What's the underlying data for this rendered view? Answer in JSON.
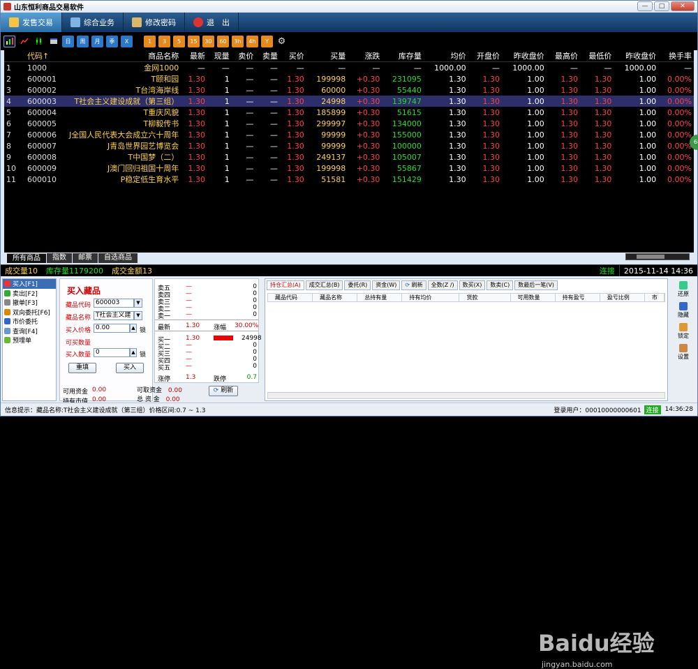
{
  "app": {
    "title": "山东恒利商品交易软件",
    "win_min": "—",
    "win_max": "□",
    "win_close": "✕"
  },
  "menu": [
    {
      "label": "发售交易"
    },
    {
      "label": "综合业务"
    },
    {
      "label": "修改密码"
    },
    {
      "label": "退　出"
    }
  ],
  "toolbar": {
    "buttons": [
      "日",
      "周",
      "月",
      "季",
      "X",
      "1",
      "3",
      "5",
      "15",
      "30",
      "60",
      "3h",
      "4h",
      "Y"
    ]
  },
  "grid": {
    "headers": [
      "",
      "代码↑",
      "商品名称",
      "最新",
      "现量",
      "卖价",
      "卖量",
      "买价",
      "买量",
      "涨跌",
      "库存量",
      "均价",
      "开盘价",
      "昨收盘价",
      "最高价",
      "最低价",
      "昨收盘价",
      "换手率"
    ],
    "rows": [
      [
        "1",
        "1000",
        "金网1000",
        "—",
        "—",
        "—",
        "—",
        "—",
        "—",
        "—",
        "—",
        "1000.00",
        "—",
        "1000.00",
        "—",
        "—",
        "1000.00",
        "—"
      ],
      [
        "2",
        "600001",
        "T颐和园",
        "1.30",
        "1",
        "—",
        "—",
        "1.30",
        "199998",
        "+0.30",
        "231095",
        "1.30",
        "1.30",
        "1.00",
        "1.30",
        "1.30",
        "1.00",
        "0.00%"
      ],
      [
        "3",
        "600002",
        "T台湾海岸线",
        "1.30",
        "1",
        "—",
        "—",
        "1.30",
        "60000",
        "+0.30",
        "55440",
        "1.30",
        "1.30",
        "1.00",
        "1.30",
        "1.30",
        "1.00",
        "0.00%"
      ],
      [
        "4",
        "600003",
        "T社会主义建设成就（第三组）",
        "1.30",
        "1",
        "—",
        "—",
        "1.30",
        "24998",
        "+0.30",
        "139747",
        "1.30",
        "1.30",
        "1.00",
        "1.30",
        "1.30",
        "1.00",
        "0.00%"
      ],
      [
        "5",
        "600004",
        "T重庆风貌",
        "1.30",
        "1",
        "—",
        "—",
        "1.30",
        "185899",
        "+0.30",
        "51615",
        "1.30",
        "1.30",
        "1.00",
        "1.30",
        "1.30",
        "1.00",
        "0.00%"
      ],
      [
        "6",
        "600005",
        "T柳毅传书",
        "1.30",
        "1",
        "—",
        "—",
        "1.30",
        "299997",
        "+0.30",
        "134000",
        "1.30",
        "1.30",
        "1.00",
        "1.30",
        "1.30",
        "1.00",
        "0.00%"
      ],
      [
        "7",
        "600006",
        "J全国人民代表大会成立六十周年",
        "1.30",
        "1",
        "—",
        "—",
        "1.30",
        "99999",
        "+0.30",
        "155000",
        "1.30",
        "1.30",
        "1.00",
        "1.30",
        "1.30",
        "1.00",
        "0.00%"
      ],
      [
        "8",
        "600007",
        "J青岛世界园艺博览会",
        "1.30",
        "1",
        "—",
        "—",
        "1.30",
        "99999",
        "+0.30",
        "100000",
        "1.30",
        "1.30",
        "1.00",
        "1.30",
        "1.30",
        "1.00",
        "0.00%"
      ],
      [
        "9",
        "600008",
        "T中国梦（二）",
        "1.30",
        "1",
        "—",
        "—",
        "1.30",
        "249137",
        "+0.30",
        "105007",
        "1.30",
        "1.30",
        "1.00",
        "1.30",
        "1.30",
        "1.00",
        "0.00%"
      ],
      [
        "10",
        "600009",
        "J澳门回归祖国十周年",
        "1.30",
        "1",
        "—",
        "—",
        "1.30",
        "199998",
        "+0.30",
        "55867",
        "1.30",
        "1.30",
        "1.00",
        "1.30",
        "1.30",
        "1.00",
        "0.00%"
      ],
      [
        "11",
        "600010",
        "P稳定低生育水平",
        "1.30",
        "1",
        "—",
        "—",
        "1.30",
        "51581",
        "+0.30",
        "151429",
        "1.30",
        "1.30",
        "1.00",
        "1.30",
        "1.30",
        "1.00",
        "0.00%"
      ]
    ],
    "selected_row": 3
  },
  "bottom_tabs": [
    "所有商品",
    "指数",
    "邮票",
    "自选商品"
  ],
  "status": {
    "volume": "成交量10",
    "stock": "库存量1179200",
    "amount": "成交金额13",
    "conn": "连接",
    "datetime": "2015-11-14 14:36"
  },
  "nav": [
    {
      "label": "买入[F1]"
    },
    {
      "label": "卖出[F2]"
    },
    {
      "label": "撤单[F3]"
    },
    {
      "label": "双向委托[F6]"
    },
    {
      "label": "市价委托"
    },
    {
      "label": "查询[F4]"
    },
    {
      "label": "预埋单"
    }
  ],
  "buy": {
    "title": "买入藏品",
    "code_label": "藏品代码",
    "code": "600003",
    "name_label": "藏品名称",
    "name": "T社会主义建设",
    "price_label": "买入价格",
    "price": "0.00",
    "lock1": "锁",
    "avail_label": "可买数量",
    "qty_label": "买入数量",
    "qty": "0",
    "lock2": "锁",
    "reset": "重填",
    "buy": "买入",
    "funds_label": "可用资金",
    "funds": "0.00",
    "mkt_label": "持有市值",
    "mkt": "0.00",
    "cash_label": "可取资金",
    "cash": "0.00",
    "total_label": "总 资 金",
    "total": "0.00",
    "refresh": "刷新"
  },
  "depth": {
    "sell": [
      [
        "卖五",
        "—",
        "0"
      ],
      [
        "卖四",
        "—",
        "0"
      ],
      [
        "卖三",
        "—",
        "0"
      ],
      [
        "卖二",
        "—",
        "0"
      ],
      [
        "卖一",
        "—",
        "0"
      ]
    ],
    "last_label": "最新",
    "last": "1.30",
    "chg_label": "涨幅",
    "chg": "30.00%",
    "buy": [
      [
        "买一",
        "1.30",
        "24998"
      ],
      [
        "买二",
        "—",
        "0"
      ],
      [
        "买三",
        "—",
        "0"
      ],
      [
        "买四",
        "—",
        "0"
      ],
      [
        "买五",
        "—",
        "0"
      ]
    ],
    "up_label": "涨停",
    "up": "1.3",
    "down_label": "跌停",
    "down": "0.7"
  },
  "hold": {
    "tabs": [
      "持仓汇总(A)",
      "成交汇总(B)",
      "委托(R)",
      "资金(W)",
      "刷新",
      "全数(Z /)",
      "数买(X)",
      "数卖(C)",
      "数最后一笔(V)"
    ],
    "headers": [
      "藏品代码",
      "藏品名称",
      "总持有量",
      "持有均价",
      "货款",
      "可用数量",
      "持有盈亏",
      "盈亏比例",
      "市"
    ]
  },
  "right": [
    "还原",
    "隐藏",
    "锁定",
    "设置"
  ],
  "footer": {
    "info": "信息提示：藏品名称:T社会主义建设成就（第三组）价格区间:0.7 ~ 1.3",
    "user": "登录用户：00010000000601",
    "conn": "连接",
    "time": "14:36:28"
  },
  "badge": "68",
  "watermark": "Baidu经验",
  "watermark2": "jingyan.baidu.com"
}
